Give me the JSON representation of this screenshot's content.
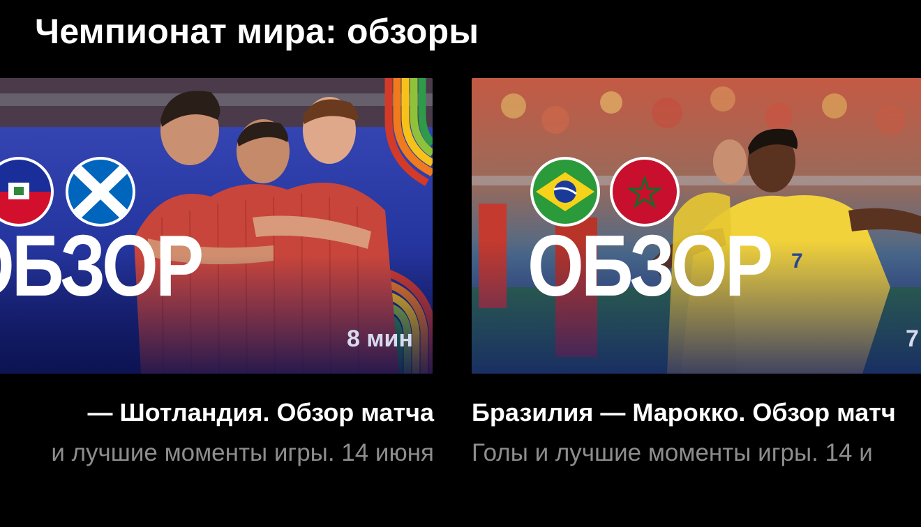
{
  "section": {
    "title": "Чемпионат мира: обзоры"
  },
  "cards": [
    {
      "badge": "ОБЗОР",
      "duration": "8 мин",
      "title": "— Шотландия. Обзор матча",
      "subtitle": "и лучшие моменты игры. 14 июня",
      "flags": [
        "haiti-flag-icon",
        "scotland-flag-icon"
      ],
      "colors": {
        "bg_top": "#2a3aa8",
        "bg_bottom": "#141e6a",
        "jersey": "#c8453b"
      }
    },
    {
      "badge": "ОБЗОР",
      "duration": "7",
      "title": "Бразилия — Марокко. Обзор матч",
      "subtitle": "Голы и лучшие моменты игры. 14 и",
      "flags": [
        "brazil-flag-icon",
        "morocco-flag-icon"
      ],
      "colors": {
        "crowd": "#c0503e",
        "pitch": "#2a5a3a",
        "jersey": "#f2d23a"
      }
    }
  ]
}
